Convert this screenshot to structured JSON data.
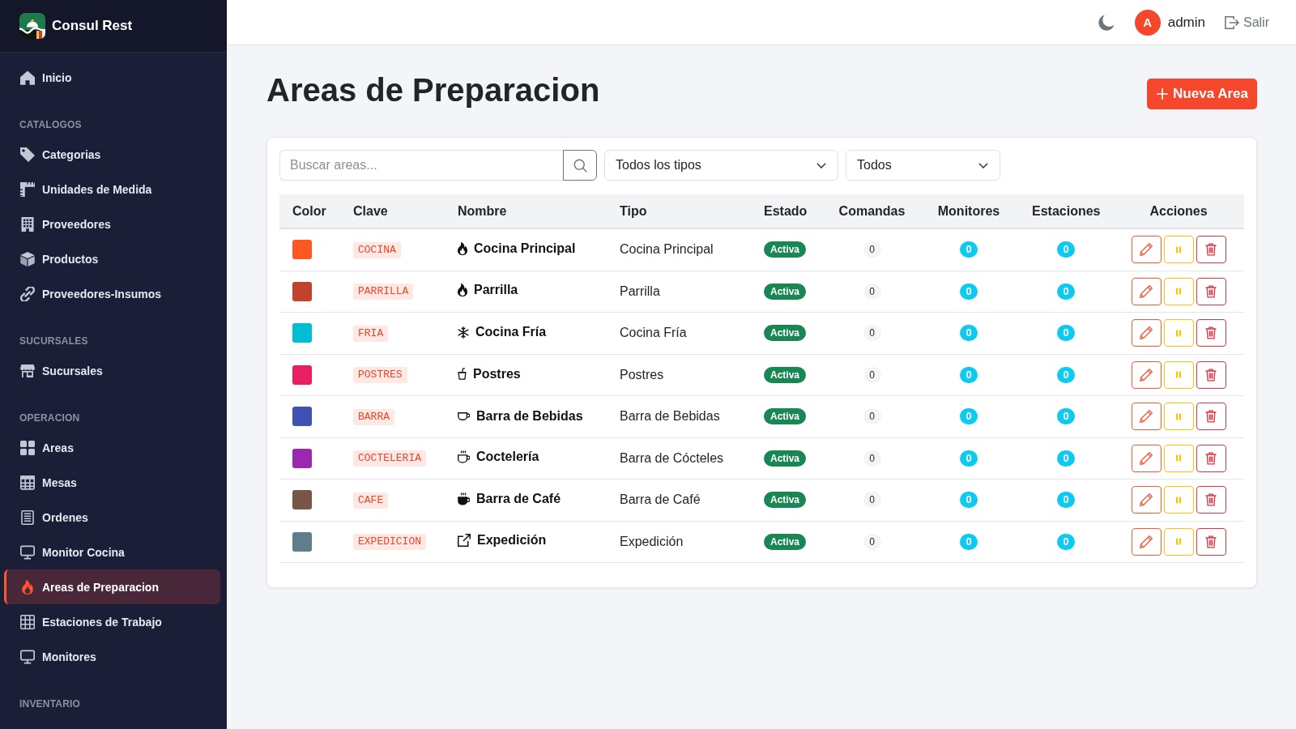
{
  "sidebar": {
    "brand": "Consul Rest",
    "sections": [
      {
        "items": [
          {
            "label": "Inicio",
            "selected": false
          }
        ]
      },
      {
        "heading": "CATALOGOS",
        "items": [
          {
            "label": "Categorias",
            "selected": false
          },
          {
            "label": "Unidades de Medida",
            "selected": false
          },
          {
            "label": "Proveedores",
            "selected": false
          },
          {
            "label": "Productos",
            "selected": false
          },
          {
            "label": "Proveedores-Insumos",
            "selected": false
          }
        ]
      },
      {
        "heading": "SUCURSALES",
        "items": [
          {
            "label": "Sucursales",
            "selected": false
          }
        ]
      },
      {
        "heading": "OPERACION",
        "items": [
          {
            "label": "Areas",
            "selected": false
          },
          {
            "label": "Mesas",
            "selected": false
          },
          {
            "label": "Ordenes",
            "selected": false
          },
          {
            "label": "Monitor Cocina",
            "selected": false
          },
          {
            "label": "Areas de Preparacion",
            "selected": true
          },
          {
            "label": "Estaciones de Trabajo",
            "selected": false
          },
          {
            "label": "Monitores",
            "selected": false
          }
        ]
      },
      {
        "heading": "INVENTARIO"
      }
    ]
  },
  "topbar": {
    "user": {
      "initial": "A",
      "name": "admin"
    },
    "logout": "Salir"
  },
  "page": {
    "title": "Areas de Preparacion",
    "new_button": "Nueva Area"
  },
  "filters": {
    "search": {
      "placeholder": "Buscar areas..."
    },
    "type_select": "Todos los tipos",
    "status_select": "Todos"
  },
  "table": {
    "columns": [
      "Color",
      "Clave",
      "Nombre",
      "Tipo",
      "Estado",
      "Comandas",
      "Monitores",
      "Estaciones",
      "Acciones"
    ],
    "rows": [
      {
        "color": "#ff5722",
        "clave": "COCINA",
        "nombre": "Cocina Principal",
        "tipo": "Cocina Principal",
        "estado": "Activa",
        "active": true,
        "comandas": "0",
        "monitores": "0",
        "estaciones": "0"
      },
      {
        "color": "#c0432f",
        "clave": "PARRILLA",
        "nombre": "Parrilla",
        "tipo": "Parrilla",
        "estado": "Activa",
        "active": true,
        "comandas": "0",
        "monitores": "0",
        "estaciones": "0"
      },
      {
        "color": "#00bcd4",
        "clave": "FRIA",
        "nombre": "Cocina Fría",
        "tipo": "Cocina Fría",
        "estado": "Activa",
        "active": true,
        "comandas": "0",
        "monitores": "0",
        "estaciones": "0"
      },
      {
        "color": "#e91e63",
        "clave": "POSTRES",
        "nombre": "Postres",
        "tipo": "Postres",
        "estado": "Activa",
        "active": true,
        "comandas": "0",
        "monitores": "0",
        "estaciones": "0"
      },
      {
        "color": "#3f51b5",
        "clave": "BARRA",
        "nombre": "Barra de Bebidas",
        "tipo": "Barra de Bebidas",
        "estado": "Activa",
        "active": true,
        "comandas": "0",
        "monitores": "0",
        "estaciones": "0"
      },
      {
        "color": "#9c27b0",
        "clave": "COCTELERIA",
        "nombre": "Coctelería",
        "tipo": "Barra de Cócteles",
        "estado": "Activa",
        "active": true,
        "comandas": "0",
        "monitores": "0",
        "estaciones": "0"
      },
      {
        "color": "#795548",
        "clave": "CAFE",
        "nombre": "Barra de Café",
        "tipo": "Barra de Café",
        "estado": "Activa",
        "active": true,
        "comandas": "0",
        "monitores": "0",
        "estaciones": "0"
      },
      {
        "color": "#607d8b",
        "clave": "EXPEDICION",
        "nombre": "Expedición",
        "tipo": "Expedición",
        "estado": "Activa",
        "active": true,
        "comandas": "0",
        "monitores": "0",
        "estaciones": "0"
      }
    ]
  }
}
